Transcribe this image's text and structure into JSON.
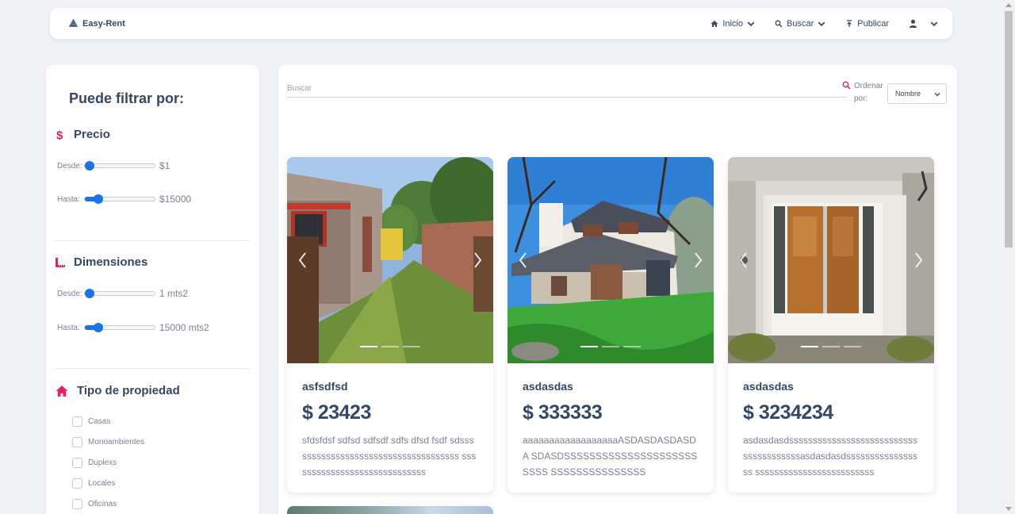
{
  "navbar": {
    "brand": "Easy-Rent",
    "items": [
      {
        "label": "Inicio",
        "icon": "home-icon"
      },
      {
        "label": "Buscar",
        "icon": "search-icon"
      },
      {
        "label": "Publicar",
        "icon": "upload-icon"
      },
      {
        "label": "",
        "icon": "user-icon"
      }
    ]
  },
  "sidebar": {
    "title": "Puede filtrar por:",
    "precio": {
      "heading": "Precio",
      "desde_label": "Desde:",
      "desde_value": "$1",
      "desde_level": 0.0,
      "hasta_label": "Hasta:",
      "hasta_value": "$15000",
      "hasta_level": 0.15
    },
    "dimensiones": {
      "heading": "Dimensiones",
      "desde_label": "Desde:",
      "desde_value": "1 mts2",
      "desde_level": 0.0,
      "hasta_label": "Hasta:",
      "hasta_value": "15000 mts2",
      "hasta_level": 0.15
    },
    "tipo": {
      "heading": "Tipo de propiedad",
      "options": [
        "Casas",
        "Monoambientes",
        "Duplexs",
        "Locales",
        "Oficinas"
      ]
    }
  },
  "main": {
    "search_placeholder": "Buscar",
    "order_label": "Ordenar por:",
    "order_selected": "Nombre",
    "cards": [
      {
        "title": "asfsdfsd",
        "price": "$ 23423",
        "description": "sfdsfdsf sdfsd sdfsdf sdfs dfsd fsdf sdssssssssssssssssssssssssssssssssssss sssssssssssssssssssssssssssss"
      },
      {
        "title": "asdasdas",
        "price": "$ 333333",
        "description": "aaaaaaaaaaaaaaaaaaASDASDASDASDA SDASDSSSSSSSSSSSSSSSSSSSSSSSSS SSSSSSSSSSSSSSS"
      },
      {
        "title": "asdasdas",
        "price": "$ 3234234",
        "description": "asdasdasdsssssssssssssssssssssssssss ssssssssssssasdasdasdsssssssssssssssss sssssssssssssssssssssssss"
      }
    ]
  },
  "colors": {
    "accent": "#e91e63",
    "slider": "#1a73e8",
    "text": "#344767",
    "muted": "#7b809a"
  }
}
